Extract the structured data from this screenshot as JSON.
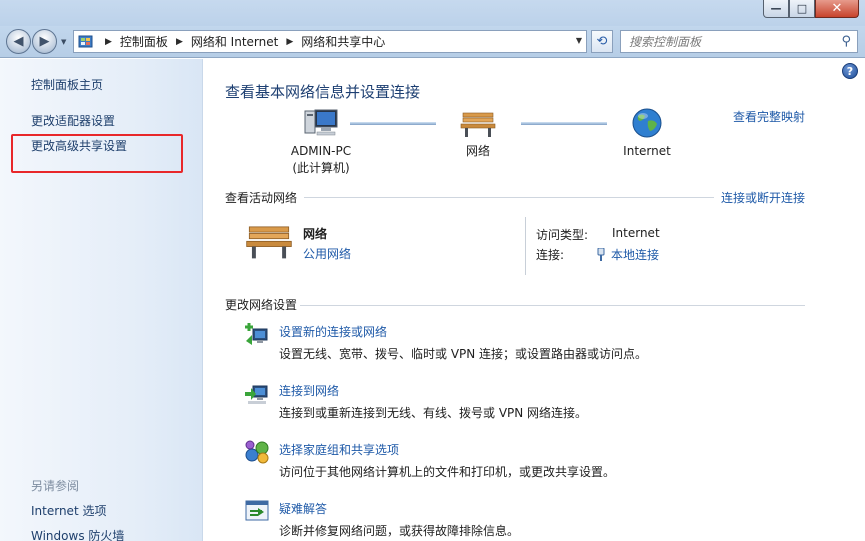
{
  "window": {
    "minimize_glyph": "—",
    "maximize_glyph": "□",
    "close_glyph": "✕"
  },
  "address_bar": {
    "crumbs": [
      "控制面板",
      "网络和 Internet",
      "网络和共享中心"
    ],
    "search_placeholder": "搜索控制面板"
  },
  "left_pane": {
    "items": [
      "控制面板主页",
      "更改适配器设置",
      "更改高级共享设置"
    ],
    "see_also_title": "另请参阅",
    "see_also": [
      "Internet 选项",
      "Windows 防火墙"
    ]
  },
  "main": {
    "title": "查看基本网络信息并设置连接",
    "full_map_link": "查看完整映射",
    "map_nodes": [
      {
        "line1": "ADMIN-PC",
        "line2": "(此计算机)"
      },
      {
        "line1": "网络",
        "line2": ""
      },
      {
        "line1": "Internet",
        "line2": ""
      }
    ],
    "active_networks": {
      "heading": "查看活动网络",
      "connect_link": "连接或断开连接",
      "network_name": "网络",
      "network_type": "公用网络",
      "access_type_label": "访问类型:",
      "access_type_value": "Internet",
      "connection_label": "连接:",
      "connection_value": "本地连接"
    },
    "change_settings": {
      "heading": "更改网络设置",
      "tasks": [
        {
          "link": "设置新的连接或网络",
          "desc": "设置无线、宽带、拨号、临时或 VPN 连接；或设置路由器或访问点。",
          "icon": "new-connection-icon"
        },
        {
          "link": "连接到网络",
          "desc": "连接到或重新连接到无线、有线、拨号或 VPN 网络连接。",
          "icon": "connect-network-icon"
        },
        {
          "link": "选择家庭组和共享选项",
          "desc": "访问位于其他网络计算机上的文件和打印机，或更改共享设置。",
          "icon": "homegroup-icon"
        },
        {
          "link": "疑难解答",
          "desc": "诊断并修复网络问题，或获得故障排除信息。",
          "icon": "troubleshoot-icon"
        }
      ]
    }
  },
  "colors": {
    "link": "#1f5aa8",
    "title": "#1d3f72",
    "highlight": "#e8272a"
  }
}
